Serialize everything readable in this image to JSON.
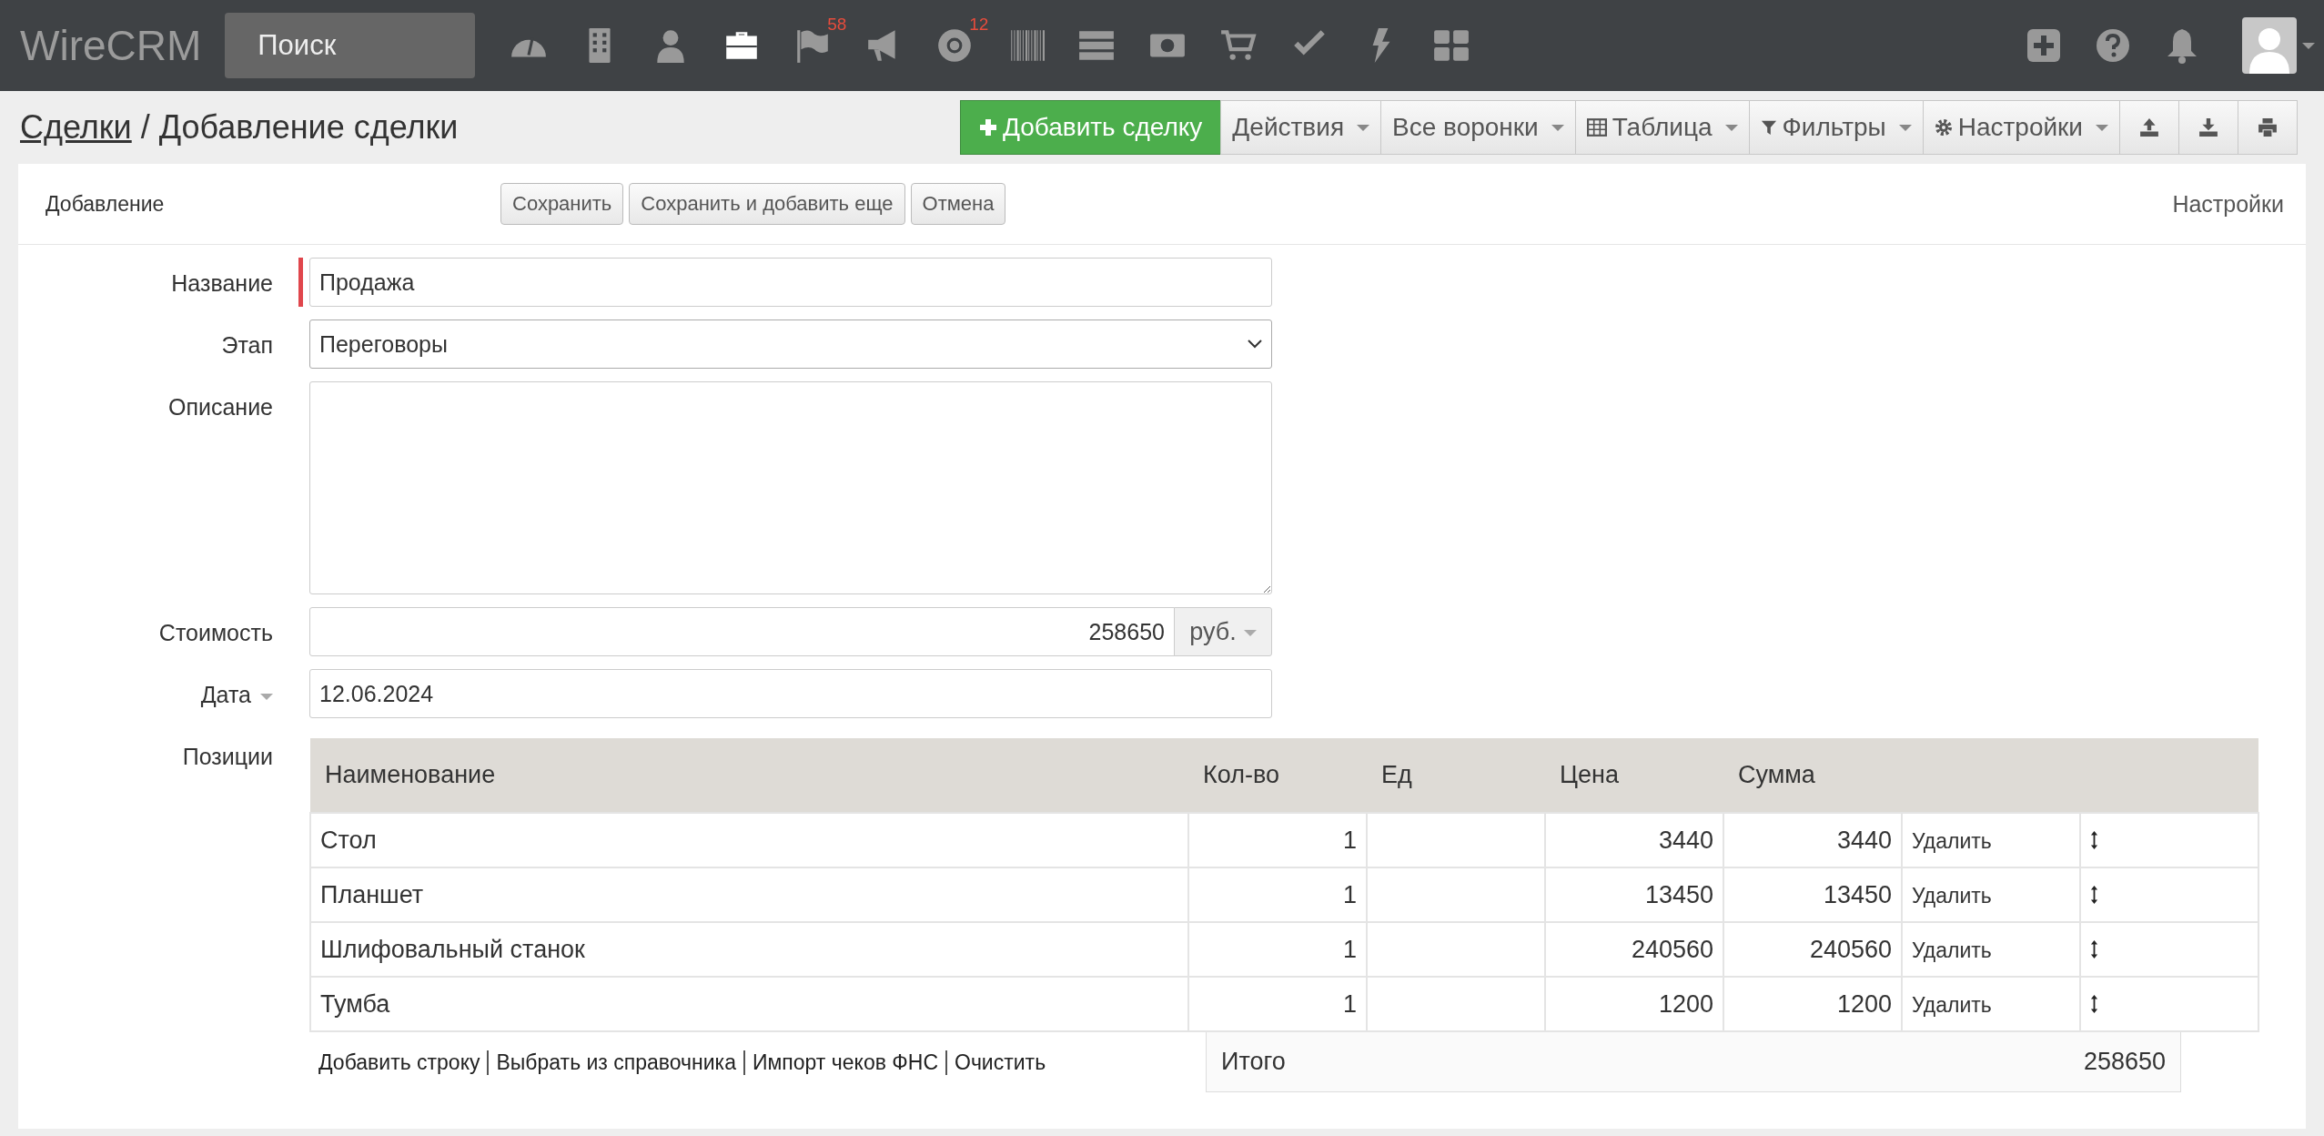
{
  "header": {
    "logo": "WireCRM",
    "search": {
      "placeholder": "Поиск"
    },
    "nav": [
      {
        "selected": false
      },
      {
        "selected": false
      },
      {
        "selected": false
      },
      {
        "selected": true
      },
      {
        "selected": false,
        "badge": "58"
      },
      {
        "selected": false
      },
      {
        "selected": false,
        "badge": "12"
      },
      {
        "selected": false
      },
      {
        "selected": false
      },
      {
        "selected": false
      },
      {
        "selected": false
      },
      {
        "selected": false
      },
      {
        "selected": false
      },
      {
        "selected": false
      }
    ]
  },
  "title": {
    "link": "Сделки",
    "text": "/ Добавление сделки"
  },
  "toolbar": [
    "Добавить сделку",
    "Действия",
    "Все воронки",
    "Таблица",
    "Фильтры",
    "Настройки"
  ],
  "form_header": {
    "title": "Добавление",
    "buttons": [
      "Сохранить",
      "Сохранить и добавить еще",
      "Отмена"
    ],
    "settings": "Настройки"
  },
  "fields": {
    "name": {
      "label": "Название",
      "value": "Продажа",
      "required": true
    },
    "stage": {
      "label": "Этап",
      "value": "Переговоры"
    },
    "description": {
      "label": "Описание"
    },
    "cost": {
      "label": "Стоимость",
      "value": "258650",
      "currency": "руб."
    },
    "date": {
      "label": "Дата",
      "value": "12.06.2024"
    }
  },
  "positions": {
    "label": "Позиции",
    "columns": [
      "Наименование",
      "Кол-во",
      "Ед",
      "Цена",
      "Сумма"
    ],
    "rows": [
      {
        "name": "Стол",
        "qty": "1",
        "price": "3440",
        "sum": "3440",
        "action": "Удалить"
      },
      {
        "name": "Планшет",
        "qty": "1",
        "price": "13450",
        "sum": "13450",
        "action": "Удалить"
      },
      {
        "name": "Шлифовальный станок",
        "qty": "1",
        "price": "240560",
        "sum": "240560",
        "action": "Удалить"
      },
      {
        "name": "Тумба",
        "qty": "1",
        "price": "1200",
        "sum": "1200",
        "action": "Удалить"
      }
    ],
    "links": [
      "Добавить строку",
      "Выбрать из справочника",
      "Импорт чеков ФНС",
      "Очистить"
    ],
    "total": {
      "label": "Итого",
      "value": "258650"
    }
  }
}
